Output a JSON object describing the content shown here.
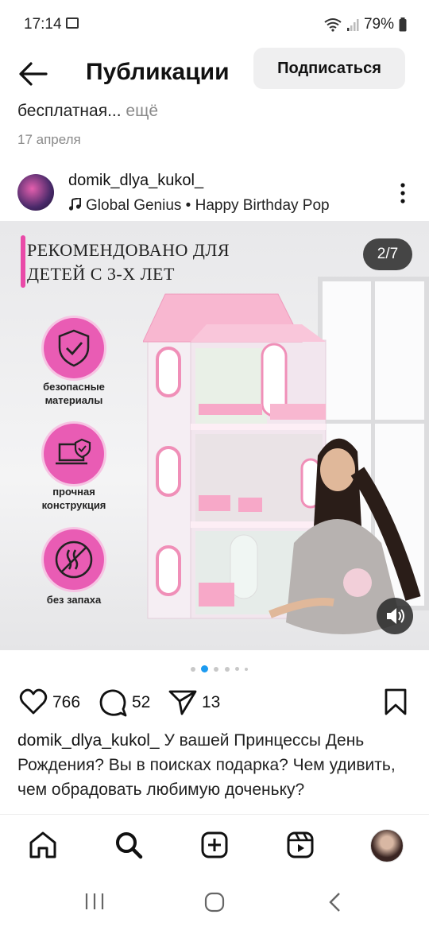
{
  "status_bar": {
    "time": "17:14",
    "battery": "79%",
    "icons": [
      "image-icon",
      "wifi-icon",
      "signal-icon",
      "battery-icon"
    ]
  },
  "header": {
    "title": "Публикации",
    "follow_label": "Подписаться"
  },
  "previous_post": {
    "caption": "бесплатная...",
    "more": " ещё",
    "date": "17 апреля"
  },
  "post": {
    "username": "domik_dlya_kukol_",
    "music": "Global Genius • Happy Birthday Pop",
    "media": {
      "headline_line1": "РЕКОМЕНДОВАНО ДЛЯ",
      "headline_line2": "ДЕТЕЙ С 3-Х ЛЕТ",
      "counter": "2/7",
      "features": [
        {
          "icon": "shield-check-icon",
          "line1": "безопасные",
          "line2": "материалы"
        },
        {
          "icon": "laptop-shield-icon",
          "line1": "прочная",
          "line2": "конструкция"
        },
        {
          "icon": "no-odor-icon",
          "line1": "без запаха",
          "line2": ""
        }
      ],
      "accent": "#e95cb4"
    },
    "carousel": {
      "count": 6,
      "active_index": 1
    },
    "likes": "766",
    "comments": "52",
    "shares": "13",
    "caption_user": "domik_dlya_kukol_",
    "caption_text": " У вашей Принцессы День Рождения? Вы в поисках подарка? Чем удивить, чем обрадовать любимую доченьку?"
  },
  "bottom_nav": [
    "home-icon",
    "search-icon",
    "create-icon",
    "reels-icon",
    "profile-avatar"
  ],
  "system_nav": [
    "recents-icon",
    "home-circle-icon",
    "back-chevron-icon"
  ]
}
